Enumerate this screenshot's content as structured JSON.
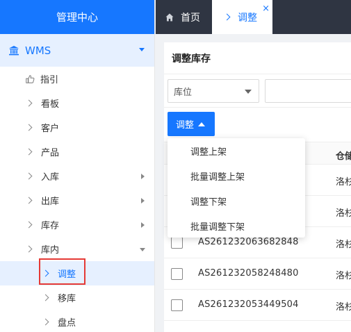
{
  "sidebar": {
    "header": "管理中心",
    "root": {
      "label": "WMS",
      "icon": "bank-icon"
    },
    "items": [
      {
        "label": "指引",
        "icon": "thumbs-up-icon"
      },
      {
        "label": "看板"
      },
      {
        "label": "客户"
      },
      {
        "label": "产品"
      },
      {
        "label": "入库"
      },
      {
        "label": "出库"
      },
      {
        "label": "库存"
      },
      {
        "label": "库内"
      }
    ],
    "sub_items": [
      {
        "label": "调整",
        "active": true
      },
      {
        "label": "移库"
      },
      {
        "label": "盘点"
      }
    ]
  },
  "tabs": [
    {
      "label": "首页",
      "icon": "home-icon"
    },
    {
      "label": "调整",
      "active": true,
      "close": "×"
    }
  ],
  "panel": {
    "title": "调整库存",
    "filter_select": "库位",
    "adjust_button": "调整"
  },
  "dropdown": {
    "items": [
      "调整上架",
      "批量调整上架",
      "调整下架",
      "批量调整下架"
    ]
  },
  "table": {
    "header_warehouse": "仓储",
    "rows": [
      {
        "code": "",
        "warehouse": "洛杉"
      },
      {
        "code": "",
        "warehouse": "洛杉"
      },
      {
        "code": "AS261232063682848",
        "warehouse": "洛杉"
      },
      {
        "code": "AS261232058248480",
        "warehouse": "洛杉"
      },
      {
        "code": "AS261232053449504",
        "warehouse": "洛杉"
      }
    ]
  },
  "colors": {
    "primary": "#1677ff",
    "topbar": "#2f3542",
    "highlight": "#e53935"
  }
}
